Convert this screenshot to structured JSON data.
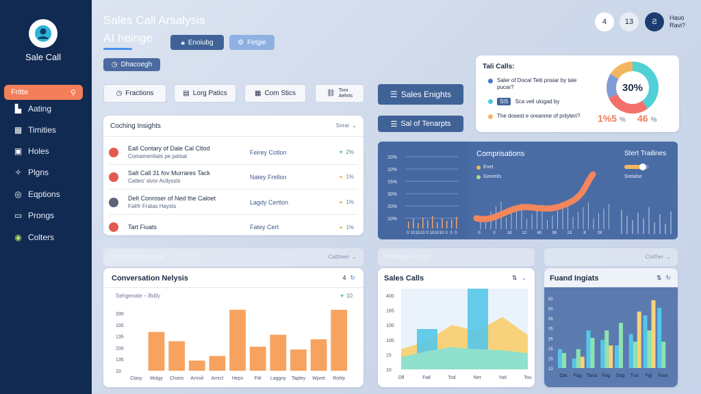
{
  "sidebar": {
    "app_name": "Sale Call",
    "active_item": "Fritte",
    "items": [
      {
        "label": "Aating",
        "icon": "chart-bar-icon"
      },
      {
        "label": "Timities",
        "icon": "grid-icon"
      },
      {
        "label": "Holes",
        "icon": "calendar-icon"
      },
      {
        "label": "Plgns",
        "icon": "spark-icon"
      },
      {
        "label": "Eqptions",
        "icon": "target-icon"
      },
      {
        "label": "Prongs",
        "icon": "folder-icon"
      },
      {
        "label": "Colters",
        "icon": "circle-check-icon"
      }
    ]
  },
  "header": {
    "title": "Sales Call Arsalysis",
    "subtitle": "AI heinge",
    "btn_primary": "Enoiubg",
    "btn_secondary": "Fetgie",
    "btn_filter": "Dhacoegh",
    "notif_count": "4",
    "msg_count": "13",
    "user_initial": "Ƨ",
    "user_line1": "Hauo",
    "user_line2": "Ravi?"
  },
  "toolbar": {
    "btn_fractions": "Fractions",
    "btn_long_paties": "Lorg Patics",
    "btn_com_stics": "Com Stics",
    "btn_thru_l1": "Tirnr",
    "btn_thru_l2": "Aehrts",
    "btn_sales_enights": "Sales Enights",
    "btn_sal_of_tenarpts": "Sal of Tenarpts"
  },
  "tali_calls": {
    "title": "Tali Calls:",
    "items": [
      {
        "text": "Saler of Docal Teiti pnsiar by tale pucar?",
        "color": "#4a78c4"
      },
      {
        "badge": "SiS",
        "text": "Sca veil ulogad by",
        "color": "#4dc6e0"
      },
      {
        "text": "The dosest e oreanme of prilyteri?",
        "color": "#f2b560"
      }
    ],
    "donut_label": "30%",
    "stat_left": "1%",
    "stat_left_num": "5",
    "stat_left_small": "%",
    "stat_right": "46",
    "stat_right_small": "%"
  },
  "coaching_insights": {
    "title": "Coching Insights",
    "sort_label": "Sorar",
    "rows": [
      {
        "line1": "Eall Contary of Dale Cal Cltod",
        "line2": "Comamentials pe patsat",
        "who": "Feirey Cotlon",
        "pct": "2%",
        "dot": "#e25a4e"
      },
      {
        "line1": "Salt Call 31 fov Murrares Tack",
        "line2": "Cattes' sivor Acilyssts",
        "who": "Natey Frellon",
        "pct": "1%",
        "dot": "#e25a4e"
      },
      {
        "line1": "Delt Conroser of Ned the Caloet",
        "line2": "Falrfr Fratas Haysts",
        "who": "Lagdy Certlon",
        "pct": "1%",
        "dot": "#5a6478"
      },
      {
        "line1": "Tart Fiuats",
        "line2": "",
        "who": "Fatey Cert",
        "pct": "1%",
        "dot": "#e25a4e"
      }
    ]
  },
  "line_chart": {
    "y_ticks": [
      "10%",
      "10%",
      "15%",
      "30%",
      "20%",
      "10%"
    ],
    "x_ticks": [
      "0",
      "10",
      "15",
      "10",
      "0",
      "10",
      "10",
      "10",
      "0",
      "0",
      "0"
    ]
  },
  "comparisons": {
    "title": "Comprisations",
    "legend1": "Enet",
    "legend2": "Genrelis",
    "x_ticks": [
      "0",
      "0",
      "18",
      "12",
      "60",
      "99",
      "23",
      "8",
      "28"
    ]
  },
  "start_trailines": {
    "title": "Stert Trailines",
    "label": "Sretalse",
    "progress": 0.75
  },
  "section_labels": {
    "coaching": "Coaching Insights",
    "coaching_right": "Cattheer",
    "pending": "Pending Filyrgs",
    "cortler": "Corther"
  },
  "conversation": {
    "title": "Conversation Nelysis",
    "subtitle": "Sehgenate – Bdily",
    "legend": "10",
    "header_num": "4",
    "y_ticks": [
      "330",
      "100",
      "135",
      "200",
      "135",
      "10"
    ]
  },
  "chart_data": [
    {
      "type": "bar",
      "title": "Conversation Nelysis",
      "categories": [
        "Clasy",
        "Molgy",
        "Choris",
        "Arrroil",
        "Amrcl",
        "Heps",
        "Fitt",
        "Laggny",
        "Tapley",
        "Wpret",
        "Rohly"
      ],
      "values": [
        0,
        210,
        160,
        55,
        80,
        330,
        130,
        195,
        115,
        170,
        330
      ],
      "ylim": [
        0,
        400
      ]
    },
    {
      "type": "area",
      "title": "Sales Calls",
      "categories": [
        "Ofl",
        "Fatl",
        "Tod",
        "Net",
        "Yatl",
        "Tou"
      ],
      "y_ticks": [
        "400",
        "165",
        "100",
        "100",
        "15",
        "10"
      ],
      "series": [
        {
          "name": "bars",
          "values": [
            0,
            200,
            0,
            400,
            0,
            0
          ]
        },
        {
          "name": "yellow",
          "values": [
            100,
            140,
            220,
            190,
            260,
            170
          ]
        },
        {
          "name": "teal",
          "values": [
            60,
            90,
            110,
            100,
            95,
            80
          ]
        }
      ],
      "ylim": [
        0,
        400
      ]
    },
    {
      "type": "bar",
      "title": "Fuand Ingiats",
      "categories": [
        "Oat",
        "Fag",
        "Tana",
        "Fag",
        "Sag",
        "Tna",
        "Fgl",
        "Fast"
      ],
      "y_ticks": [
        "50",
        "50",
        "35",
        "35",
        "35",
        "25",
        "20",
        "10"
      ],
      "series": [
        {
          "name": "blue",
          "values": [
            10,
            5,
            20,
            15,
            12,
            18,
            28,
            32
          ]
        },
        {
          "name": "green",
          "values": [
            8,
            10,
            16,
            20,
            24,
            14,
            20,
            14
          ]
        },
        {
          "name": "yellow",
          "values": [
            0,
            6,
            0,
            12,
            0,
            30,
            36,
            0
          ]
        }
      ],
      "ylim": [
        0,
        40
      ]
    }
  ]
}
